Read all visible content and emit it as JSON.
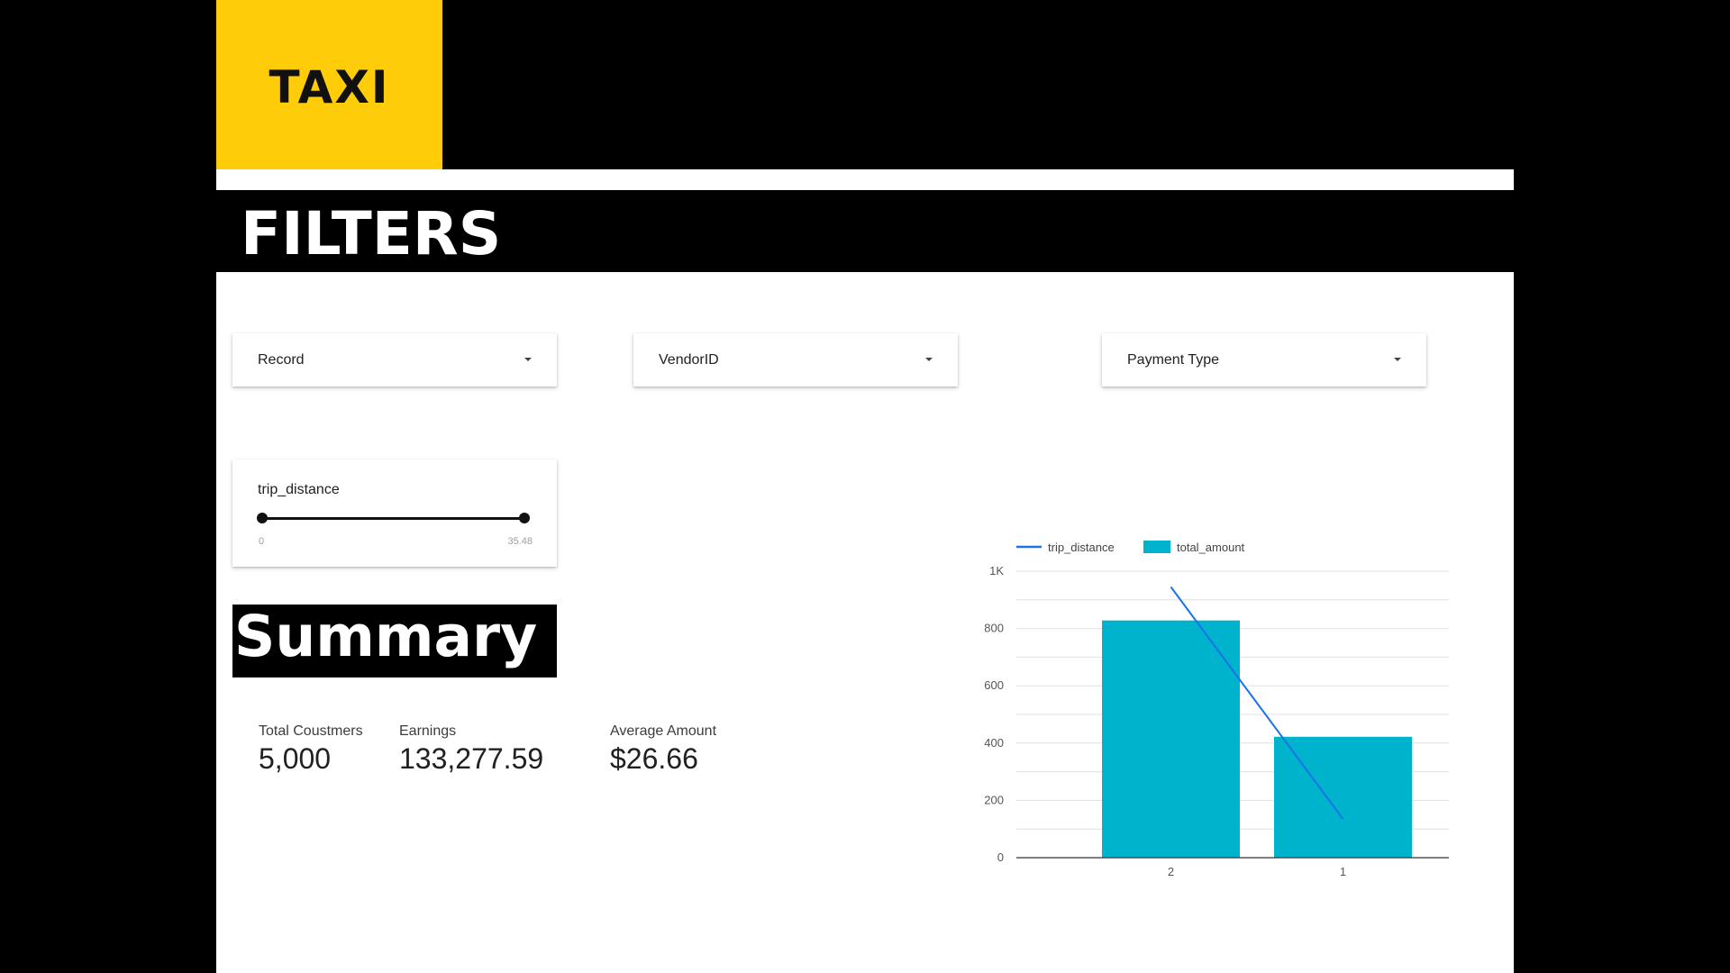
{
  "brand": {
    "logo_text": "TAXI",
    "accent_color": "#ffcc0a",
    "band_color": "#000000"
  },
  "filters": {
    "title": "FILTERS",
    "dropdowns": [
      {
        "label": "Record"
      },
      {
        "label": "VendorID"
      },
      {
        "label": "Payment Type"
      }
    ],
    "slider": {
      "label": "trip_distance",
      "min_label": "0",
      "max_label": "35.48",
      "range_low": 0,
      "range_high": 35.48
    }
  },
  "summary": {
    "title": "Summary",
    "cards": [
      {
        "label": "Total Coustmers",
        "value": "5,000"
      },
      {
        "label": "Earnings",
        "value": "133,277.59"
      },
      {
        "label": "Average Amount",
        "value": "$26.66"
      }
    ]
  },
  "chart_data": {
    "type": "bar",
    "categories": [
      "2",
      "1"
    ],
    "series": [
      {
        "name": "total_amount",
        "type": "bar",
        "color": "#00b3cc",
        "values": [
          828,
          422
        ]
      },
      {
        "name": "trip_distance",
        "type": "line",
        "color": "#1a73e8",
        "values": [
          945,
          135
        ]
      }
    ],
    "ylim": [
      0,
      1000
    ],
    "y_ticks": [
      "0",
      "200",
      "400",
      "600",
      "800",
      "1K"
    ],
    "grid": true,
    "legend_position": "top-left"
  }
}
